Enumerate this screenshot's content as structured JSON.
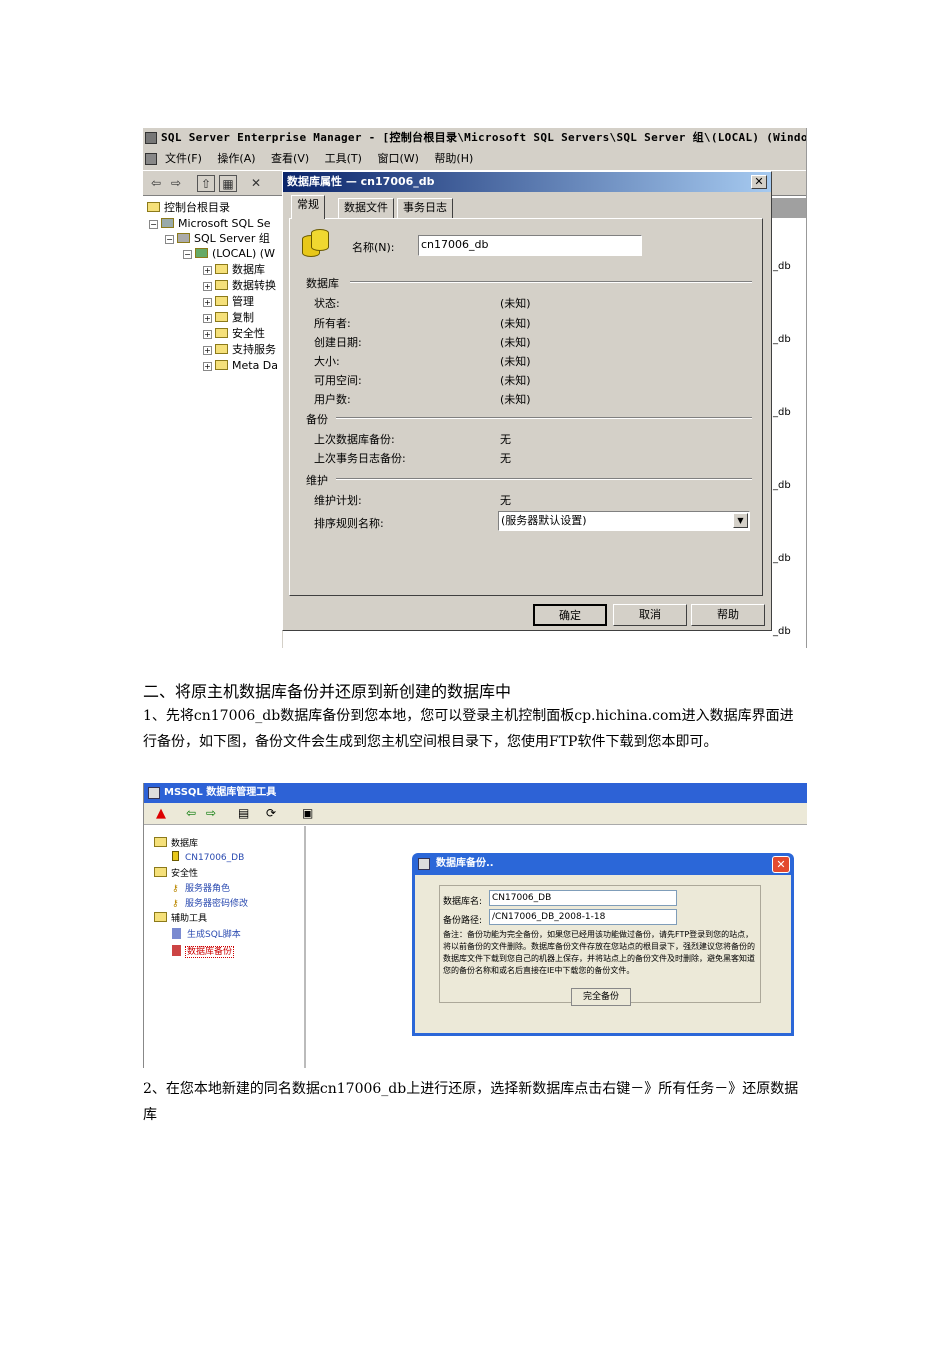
{
  "shot1": {
    "window_title": "SQL Server Enterprise Manager - [控制台根目录\\Microsoft SQL Servers\\SQL Server 组\\(LOCAL) (Windo",
    "menu": [
      "文件(F)",
      "操作(A)",
      "查看(V)",
      "工具(T)",
      "窗口(W)",
      "帮助(H)"
    ],
    "tree": {
      "root": "控制台根目录",
      "ms": "Microsoft SQL Se",
      "group": "SQL Server 组",
      "local": "(LOCAL) (W",
      "items": [
        "数据库",
        "数据转换",
        "管理",
        "复制",
        "安全性",
        "支持服务",
        "Meta Da"
      ]
    },
    "right_col": "_db",
    "dialog": {
      "title": "数据库属性 — cn17006_db",
      "tabs": [
        "常规",
        "数据文件",
        "事务日志"
      ],
      "name_label": "名称(N):",
      "name_value": "cn17006_db",
      "group_db": "数据库",
      "db_rows": [
        {
          "label": "状态:",
          "value": "(未知)"
        },
        {
          "label": "所有者:",
          "value": "(未知)"
        },
        {
          "label": "创建日期:",
          "value": "(未知)"
        },
        {
          "label": "大小:",
          "value": "(未知)"
        },
        {
          "label": "可用空间:",
          "value": "(未知)"
        },
        {
          "label": "用户数:",
          "value": "(未知)"
        }
      ],
      "group_backup": "备份",
      "backup_rows": [
        {
          "label": "上次数据库备份:",
          "value": "无"
        },
        {
          "label": "上次事务日志备份:",
          "value": "无"
        }
      ],
      "group_maint": "维护",
      "maint_plan_label": "维护计划:",
      "maint_plan_value": "无",
      "collation_label": "排序规则名称:",
      "collation_value": "(服务器默认设置)",
      "btn_ok": "确定",
      "btn_cancel": "取消",
      "btn_help": "帮助"
    }
  },
  "text": {
    "heading": "二、将原主机数据库备份并还原到新创建的数据库中",
    "para1": "1、先将cn17006_db数据库备份到您本地，您可以登录主机控制面板cp.hichina.com进入数据库界面进行备份，如下图，备份文件会生成到您主机空间根目录下，您使用FTP软件下载到您本即可。",
    "para2": "2、在您本地新建的同名数据cn17006_db上进行还原，选择新数据库点击右键－》所有任务－》还原数据库"
  },
  "shot2": {
    "window_title": "MSSQL 数据库管理工具",
    "tree": {
      "db": "数据库",
      "db_item": "CN17006_DB",
      "security": "安全性",
      "role": "服务器角色",
      "pwd": "服务器密码修改",
      "tools": "辅助工具",
      "sql": "生成SQL脚本",
      "backup": "数据库备份"
    },
    "dialog": {
      "title": "数据库备份..",
      "db_label": "数据库名:",
      "db_value": "CN17006_DB",
      "path_label": "备份路径:",
      "path_value": "/CN17006_DB_2008-1-18",
      "note": "备注：备份功能为完全备份，如果您已经用该功能做过备份，请先FTP登录到您的站点，将以前备份的文件删除。数据库备份文件存放在您站点的根目录下，强烈建议您将备份的数据库文件下载到您自己的机器上保存，并将站点上的备份文件及时删除，避免黑客知道您的备份名称和或名后直接在IE中下载您的备份文件。",
      "btn_full": "完全备份"
    }
  }
}
